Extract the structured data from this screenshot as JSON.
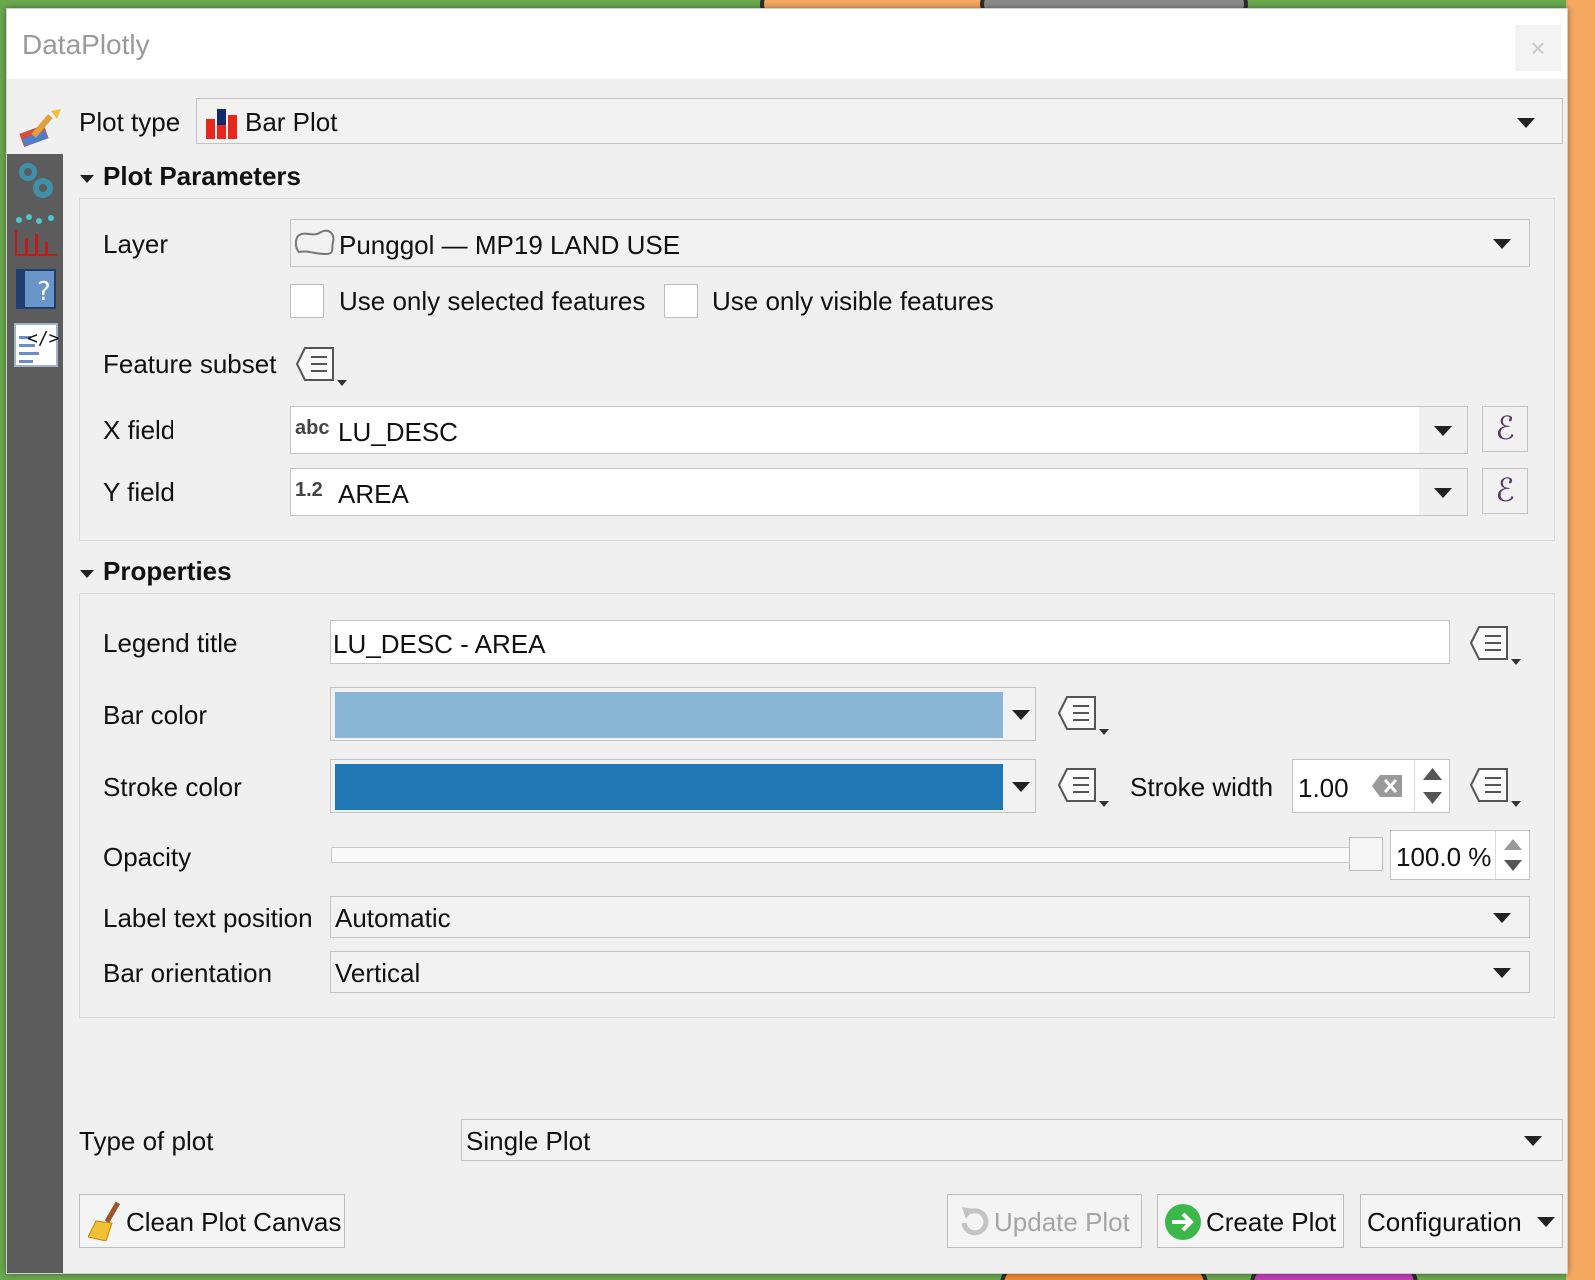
{
  "window": {
    "title": "DataPlotly",
    "close_glyph": "×"
  },
  "plot_type": {
    "label": "Plot type",
    "value": "Bar Plot"
  },
  "plot_parameters": {
    "header": "Plot Parameters",
    "layer_label": "Layer",
    "layer_value": "Punggol — MP19 LAND USE",
    "selected_features_label": "Use only selected features",
    "visible_features_label": "Use only visible features",
    "feature_subset_label": "Feature subset",
    "x_field_label": "X field",
    "x_field_type": "abc",
    "x_field_value": "LU_DESC",
    "y_field_label": "Y field",
    "y_field_type": "1.2",
    "y_field_value": "AREA",
    "expression_glyph": "ℰ"
  },
  "properties": {
    "header": "Properties",
    "legend_title_label": "Legend title",
    "legend_title_value": "LU_DESC - AREA",
    "bar_color_label": "Bar color",
    "bar_color": "#8ab6d6",
    "stroke_color_label": "Stroke color",
    "stroke_color": "#2176b4",
    "stroke_width_label": "Stroke width",
    "stroke_width_value": "1.00",
    "opacity_label": "Opacity",
    "opacity_value": "100.0 %",
    "opacity_fraction": 1.0,
    "label_position_label": "Label text position",
    "label_position_value": "Automatic",
    "bar_orientation_label": "Bar orientation",
    "bar_orientation_value": "Vertical"
  },
  "type_of_plot": {
    "label": "Type of plot",
    "value": "Single Plot"
  },
  "buttons": {
    "clean": "Clean Plot Canvas",
    "update": "Update Plot",
    "create": "Create Plot",
    "configuration": "Configuration"
  },
  "sidebar": {
    "icons": [
      "gears-icon",
      "scatter-bars-icon",
      "help-icon",
      "code-icon"
    ]
  }
}
